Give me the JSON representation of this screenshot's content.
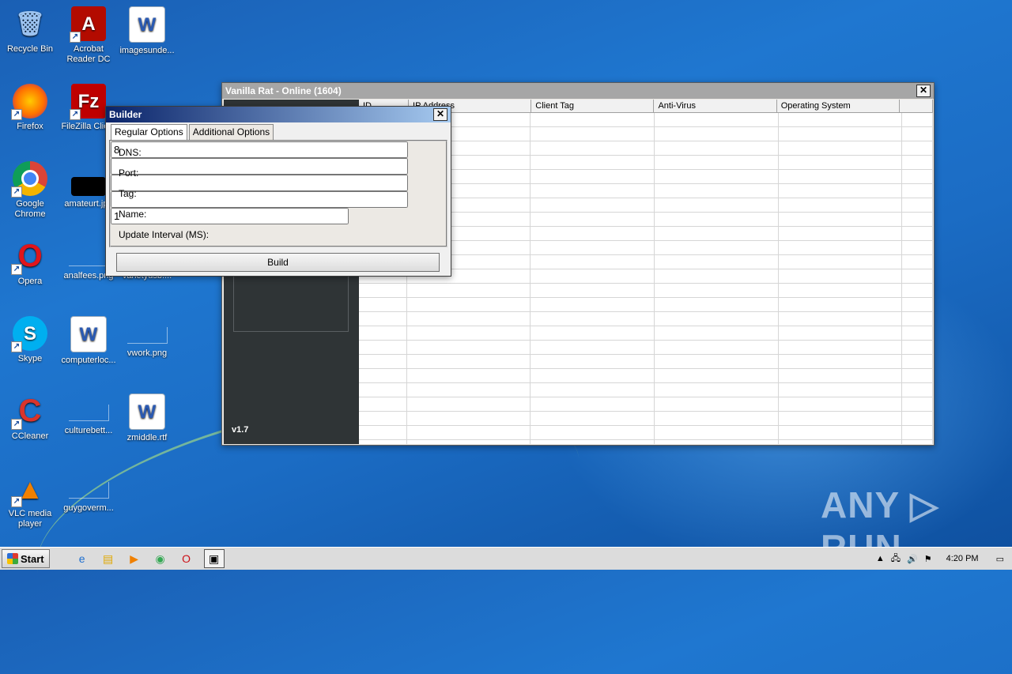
{
  "desktop": {
    "icons": [
      {
        "label": "Recycle Bin",
        "glyph": "🗑",
        "color": "#5b8fd6"
      },
      {
        "label": "Acrobat\nReader DC",
        "glyph": "A",
        "color": "#b30b00"
      },
      {
        "label": "imagesunde...",
        "glyph": "W",
        "color": "#2a5ab3"
      },
      {
        "label": "Firefox",
        "glyph": "●",
        "color": "#e66000"
      },
      {
        "label": "FileZilla Clie...",
        "glyph": "Fz",
        "color": "#bf0000"
      },
      {
        "label": "Google\nChrome",
        "glyph": "◉",
        "color": "#34a853"
      },
      {
        "label": "amateurt.jpg",
        "glyph": "",
        "color": "#000000"
      },
      {
        "label": "Opera",
        "glyph": "O",
        "color": "#cc0f16"
      },
      {
        "label": "analfees.png",
        "glyph": "",
        "color": ""
      },
      {
        "label": "varietyusb....",
        "glyph": "",
        "color": ""
      },
      {
        "label": "Skype",
        "glyph": "S",
        "color": "#00aff0"
      },
      {
        "label": "computerloc...",
        "glyph": "W",
        "color": "#2a5ab3"
      },
      {
        "label": "vwork.png",
        "glyph": "",
        "color": ""
      },
      {
        "label": "CCleaner",
        "glyph": "C",
        "color": "#d9342b"
      },
      {
        "label": "culturebett...",
        "glyph": "",
        "color": ""
      },
      {
        "label": "zmiddle.rtf",
        "glyph": "W",
        "color": "#2a5ab3"
      },
      {
        "label": "VLC media\nplayer",
        "glyph": "▲",
        "color": "#f08000"
      },
      {
        "label": "guygoverm...",
        "glyph": "",
        "color": ""
      }
    ]
  },
  "rat_window": {
    "title": "Vanilla Rat - Online (1604)",
    "close_glyph": "✕",
    "version": "v1.7",
    "columns": [
      "ID",
      "IP Address",
      "Client Tag",
      "Anti-Virus",
      "Operating System",
      ""
    ]
  },
  "builder": {
    "title": "Builder",
    "close_glyph": "✕",
    "tabs": [
      "Regular Options",
      "Additional Options"
    ],
    "fields": {
      "dns": {
        "label": "DNS:",
        "value": "8"
      },
      "port": {
        "label": "Port:",
        "value": ""
      },
      "tag": {
        "label": "Tag:",
        "value": ""
      },
      "name": {
        "label": "Name:",
        "value": ""
      },
      "update_interval": {
        "label": "Update Interval (MS):",
        "value": "1"
      }
    },
    "build_label": "Build"
  },
  "taskbar": {
    "start_label": "Start",
    "icons": [
      "ie-icon",
      "explorer-icon",
      "media-player-icon",
      "chrome-icon",
      "opera-icon",
      "app-window-icon"
    ],
    "clock": "4:20 PM"
  },
  "watermark": "ANY ▷ RUN"
}
